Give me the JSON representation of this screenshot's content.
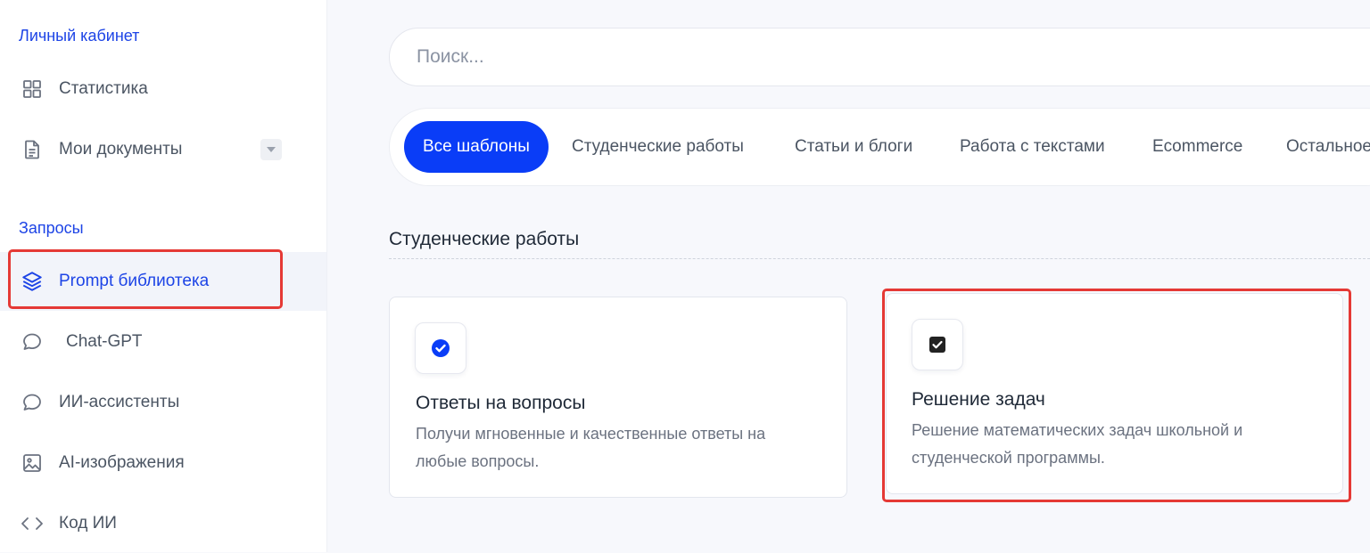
{
  "sidebar": {
    "section_account": "Личный кабинет",
    "section_requests": "Запросы",
    "items": [
      {
        "label": "Статистика",
        "icon": "grid-icon"
      },
      {
        "label": "Мои документы",
        "icon": "document-icon"
      },
      {
        "label": "Prompt библиотека",
        "icon": "layers-icon",
        "active": true
      },
      {
        "label": "Chat-GPT",
        "icon": "chat-bubble-icon"
      },
      {
        "label": "ИИ-ассистенты",
        "icon": "chat-bubble-icon"
      },
      {
        "label": "AI-изображения",
        "icon": "image-icon"
      },
      {
        "label": "Код ИИ",
        "icon": "code-icon"
      }
    ]
  },
  "search": {
    "placeholder": "Поиск..."
  },
  "tabs": [
    {
      "label": "Все шаблоны",
      "active": true
    },
    {
      "label": "Студенческие работы"
    },
    {
      "label": "Статьи и блоги"
    },
    {
      "label": "Работа с текстами"
    },
    {
      "label": "Ecommerce"
    },
    {
      "label": "Остальное"
    }
  ],
  "section": {
    "title": "Студенческие работы"
  },
  "cards": [
    {
      "title": "Ответы на вопросы",
      "description_line1": "Получи мгновенные и качественные ответы на",
      "description_line2": "любые вопросы.",
      "icon": "check-circle-icon"
    },
    {
      "title": "Решение задач",
      "description_line1": "Решение математических задач школьной и",
      "description_line2": "студенческой программы.",
      "icon": "checkbox-icon"
    }
  ],
  "colors": {
    "accent": "#0a3df7",
    "sidebar_section": "#1d44e6",
    "highlight": "#e53935"
  }
}
